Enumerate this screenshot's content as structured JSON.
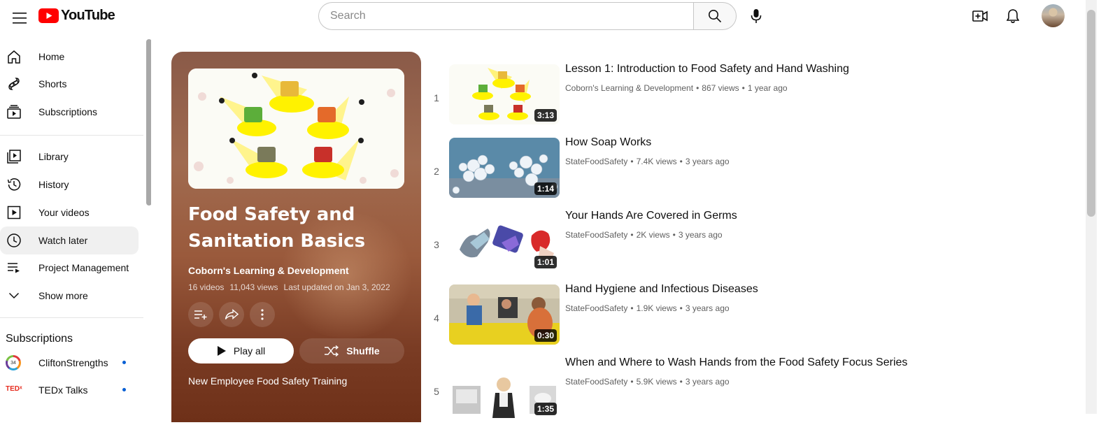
{
  "header": {
    "logo_text": "YouTube",
    "search_placeholder": "Search"
  },
  "sidebar": {
    "items": [
      {
        "label": "Home",
        "icon": "home-icon"
      },
      {
        "label": "Shorts",
        "icon": "shorts-icon"
      },
      {
        "label": "Subscriptions",
        "icon": "subscriptions-icon"
      },
      {
        "label": "Library",
        "icon": "library-icon"
      },
      {
        "label": "History",
        "icon": "history-icon"
      },
      {
        "label": "Your videos",
        "icon": "your-videos-icon"
      },
      {
        "label": "Watch later",
        "icon": "watch-later-icon",
        "active": true
      },
      {
        "label": "Project Management",
        "icon": "playlist-icon"
      },
      {
        "label": "Show more",
        "icon": "chevron-down-icon"
      }
    ],
    "subscriptions_heading": "Subscriptions",
    "subscriptions": [
      {
        "name": "CliftonStrengths",
        "icon": "cliftonstrengths-avatar"
      },
      {
        "name": "TEDx Talks",
        "icon": "tedx-avatar"
      }
    ]
  },
  "playlist": {
    "title": "Food Safety and Sanitation Basics",
    "channel": "Coborn's Learning & Development",
    "video_count": "16 videos",
    "views": "11,043 views",
    "updated": "Last updated on Jan 3, 2022",
    "play_all_label": "Play all",
    "shuffle_label": "Shuffle",
    "description": "New Employee Food Safety Training",
    "accent_color": "#8a4a30"
  },
  "videos": [
    {
      "index": "1",
      "title": "Lesson 1: Introduction to Food Safety and Hand Washing",
      "channel": "Coborn's Learning & Development",
      "views": "867 views",
      "age": "1 year ago",
      "duration": "3:13"
    },
    {
      "index": "2",
      "title": "How Soap Works",
      "channel": "StateFoodSafety",
      "views": "7.4K views",
      "age": "3 years ago",
      "duration": "1:14"
    },
    {
      "index": "3",
      "title": "Your Hands Are Covered in Germs",
      "channel": "StateFoodSafety",
      "views": "2K views",
      "age": "3 years ago",
      "duration": "1:01"
    },
    {
      "index": "4",
      "title": "Hand Hygiene and Infectious Diseases",
      "channel": "StateFoodSafety",
      "views": "1.9K views",
      "age": "3 years ago",
      "duration": "0:30"
    },
    {
      "index": "5",
      "title": "When and Where to Wash Hands from the Food Safety Focus Series",
      "channel": "StateFoodSafety",
      "views": "5.9K views",
      "age": "3 years ago",
      "duration": "1:35"
    }
  ]
}
